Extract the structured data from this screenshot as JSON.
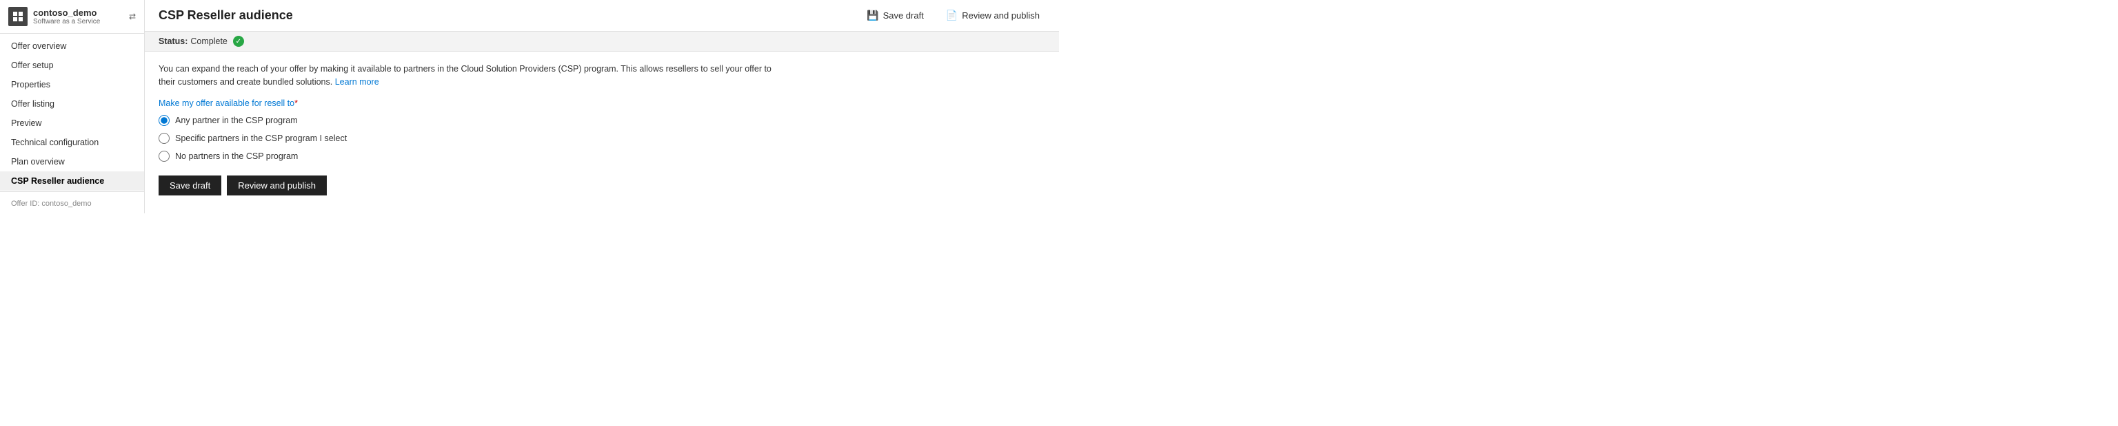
{
  "sidebar": {
    "app_name": "contoso_demo",
    "app_subtitle": "Software as a Service",
    "expand_icon": "⇄",
    "nav_items": [
      {
        "id": "offer-overview",
        "label": "Offer overview",
        "active": false
      },
      {
        "id": "offer-setup",
        "label": "Offer setup",
        "active": false
      },
      {
        "id": "properties",
        "label": "Properties",
        "active": false
      },
      {
        "id": "offer-listing",
        "label": "Offer listing",
        "active": false
      },
      {
        "id": "preview",
        "label": "Preview",
        "active": false
      },
      {
        "id": "technical-configuration",
        "label": "Technical configuration",
        "active": false
      },
      {
        "id": "plan-overview",
        "label": "Plan overview",
        "active": false
      },
      {
        "id": "csp-reseller-audience",
        "label": "CSP Reseller audience",
        "active": true
      }
    ],
    "offer_id_label": "Offer ID: contoso_demo"
  },
  "header": {
    "page_title": "CSP Reseller audience",
    "save_draft_label": "Save draft",
    "review_publish_label": "Review and publish"
  },
  "status": {
    "label": "Status:",
    "value": "Complete",
    "icon": "✓"
  },
  "content": {
    "description": "You can expand the reach of your offer by making it available to partners in the Cloud Solution Providers (CSP) program. This allows resellers to sell your offer to their customers and create bundled solutions.",
    "learn_more_label": "Learn more",
    "section_label": "Make my offer available for resell to",
    "required_mark": "*",
    "radio_options": [
      {
        "id": "any-partner",
        "label": "Any partner in the CSP program",
        "checked": true
      },
      {
        "id": "specific-partners",
        "label": "Specific partners in the CSP program I select",
        "checked": false
      },
      {
        "id": "no-partners",
        "label": "No partners in the CSP program",
        "checked": false
      }
    ],
    "save_draft_btn": "Save draft",
    "review_publish_btn": "Review and publish"
  }
}
